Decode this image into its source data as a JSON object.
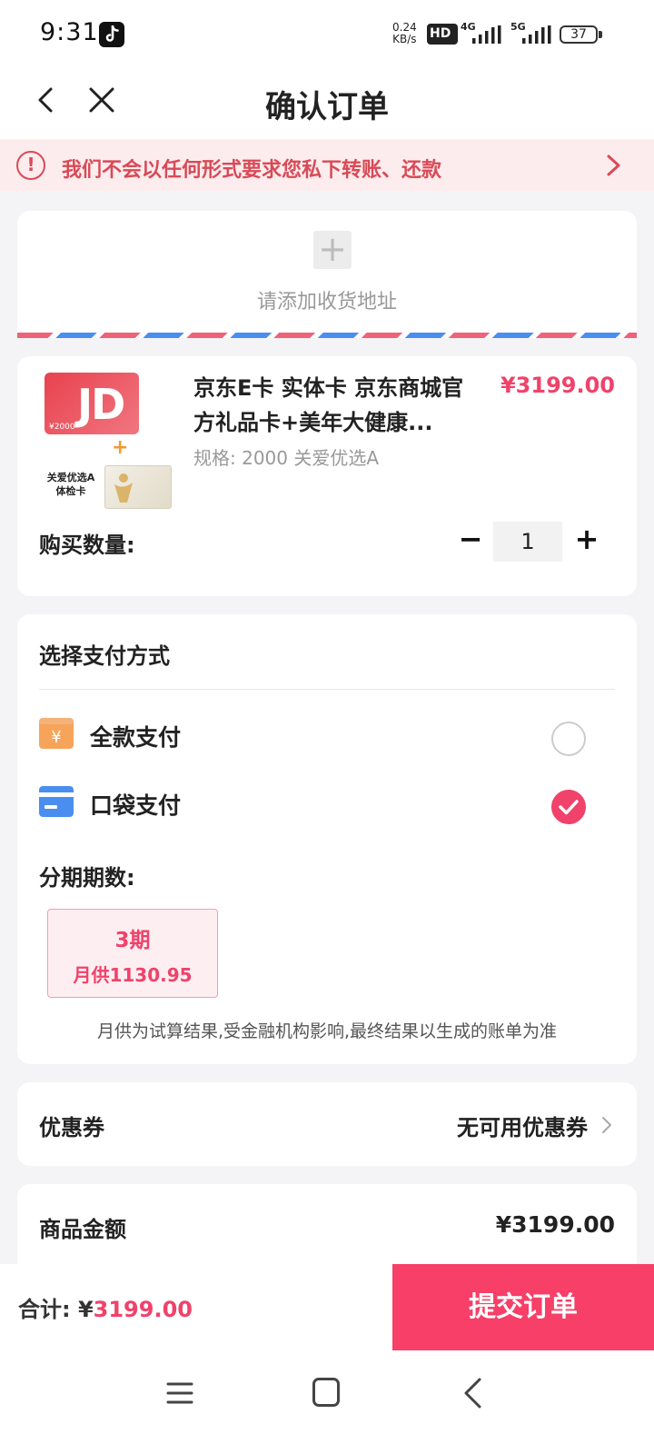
{
  "status_bar": {
    "time": "9:31",
    "speed_value": "0.24",
    "speed_unit": "KB/s",
    "hd_label": "HD",
    "net1": "4G",
    "net2": "5G",
    "battery": "37"
  },
  "header": {
    "title": "确认订单"
  },
  "warning": {
    "text": "我们不会以任何形式要求您私下转账、还款"
  },
  "address": {
    "placeholder": "请添加收货地址"
  },
  "product": {
    "name": "京东E卡 实体卡 京东商城官方礼品卡+美年大健康...",
    "price": "¥3199.00",
    "spec": "规格: 2000 关爱优选A",
    "card_amount": "¥2000",
    "bundle_label": "关爱优选A 体检卡",
    "quantity_label": "购买数量:",
    "quantity": "1",
    "minus": "−",
    "plus": "+"
  },
  "payment": {
    "title": "选择支付方式",
    "options": [
      {
        "label": "全款支付",
        "icon": "yen-wallet-icon",
        "selected": false
      },
      {
        "label": "口袋支付",
        "icon": "card-icon",
        "selected": true
      }
    ],
    "installment_label": "分期期数:",
    "installment": {
      "periods": "3期",
      "monthly": "月供1130.95"
    },
    "note": "月供为试算结果,受金融机构影响,最终结果以生成的账单为准"
  },
  "coupon": {
    "label": "优惠券",
    "value": "无可用优惠券"
  },
  "amount": {
    "label": "商品金额",
    "value": "¥3199.00"
  },
  "bottom": {
    "total_label": "合计: ¥",
    "total_value": "3199.00",
    "submit": "提交订单"
  },
  "colors": {
    "accent": "#f73f68",
    "warning": "#d84a57",
    "warning_bg": "#fdeced"
  }
}
